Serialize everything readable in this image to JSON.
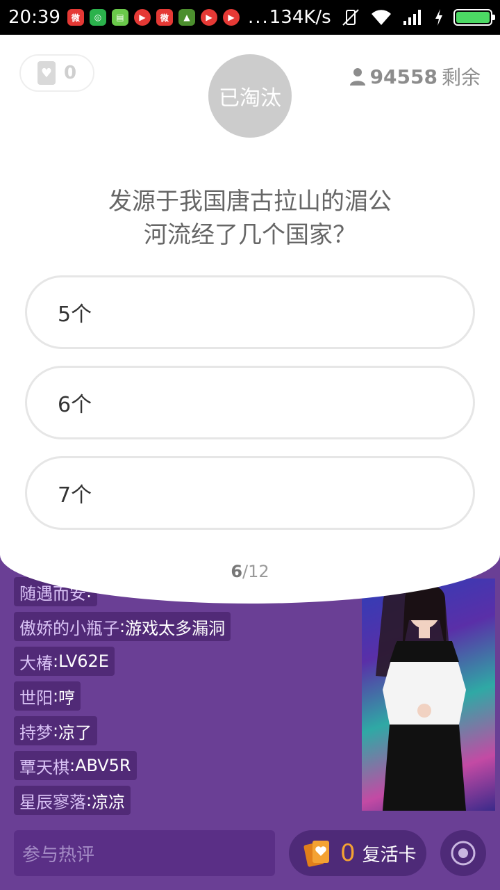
{
  "status_bar": {
    "time": "20:39",
    "more": "...",
    "network_speed": "134K/s",
    "battery_level": 1.0,
    "icons": [
      "weibo-icon",
      "wechat-icon",
      "notes-icon",
      "video-app-icon",
      "weibo-icon",
      "android-icon",
      "video-app-icon",
      "video-app-icon",
      "vibrate-off-icon",
      "wifi-icon",
      "signal-icon",
      "charging-icon",
      "battery-icon"
    ]
  },
  "quiz": {
    "lives_count": "0",
    "status_label": "已淘汰",
    "remaining_count": "94558",
    "remaining_label": "剩余",
    "question_line1": "发源于我国唐古拉山的湄公",
    "question_line2": "河流经了几个国家？",
    "options": [
      {
        "label": "5个"
      },
      {
        "label": "6个"
      },
      {
        "label": "7个"
      }
    ],
    "progress_current": "6",
    "progress_total": "/12"
  },
  "chat": {
    "messages": [
      {
        "user": "随遇而安",
        "text": ""
      },
      {
        "user": "傲娇的小瓶子",
        "text": "游戏太多漏洞"
      },
      {
        "user": "大椿",
        "text": "LV62E"
      },
      {
        "user": "世阳",
        "text": "哼"
      },
      {
        "user": "持梦",
        "text": "凉了"
      },
      {
        "user": "覃天棋",
        "text": "ABV5R"
      },
      {
        "user": "星辰寥落",
        "text": "凉凉"
      }
    ],
    "separator": ": "
  },
  "bottom": {
    "comment_placeholder": "参与热评",
    "revive_count": "0",
    "revive_label": "复活卡"
  },
  "colors": {
    "background": "#6a3f95",
    "accent_orange": "#f4a233",
    "eliminated_gray": "#cccccc"
  }
}
